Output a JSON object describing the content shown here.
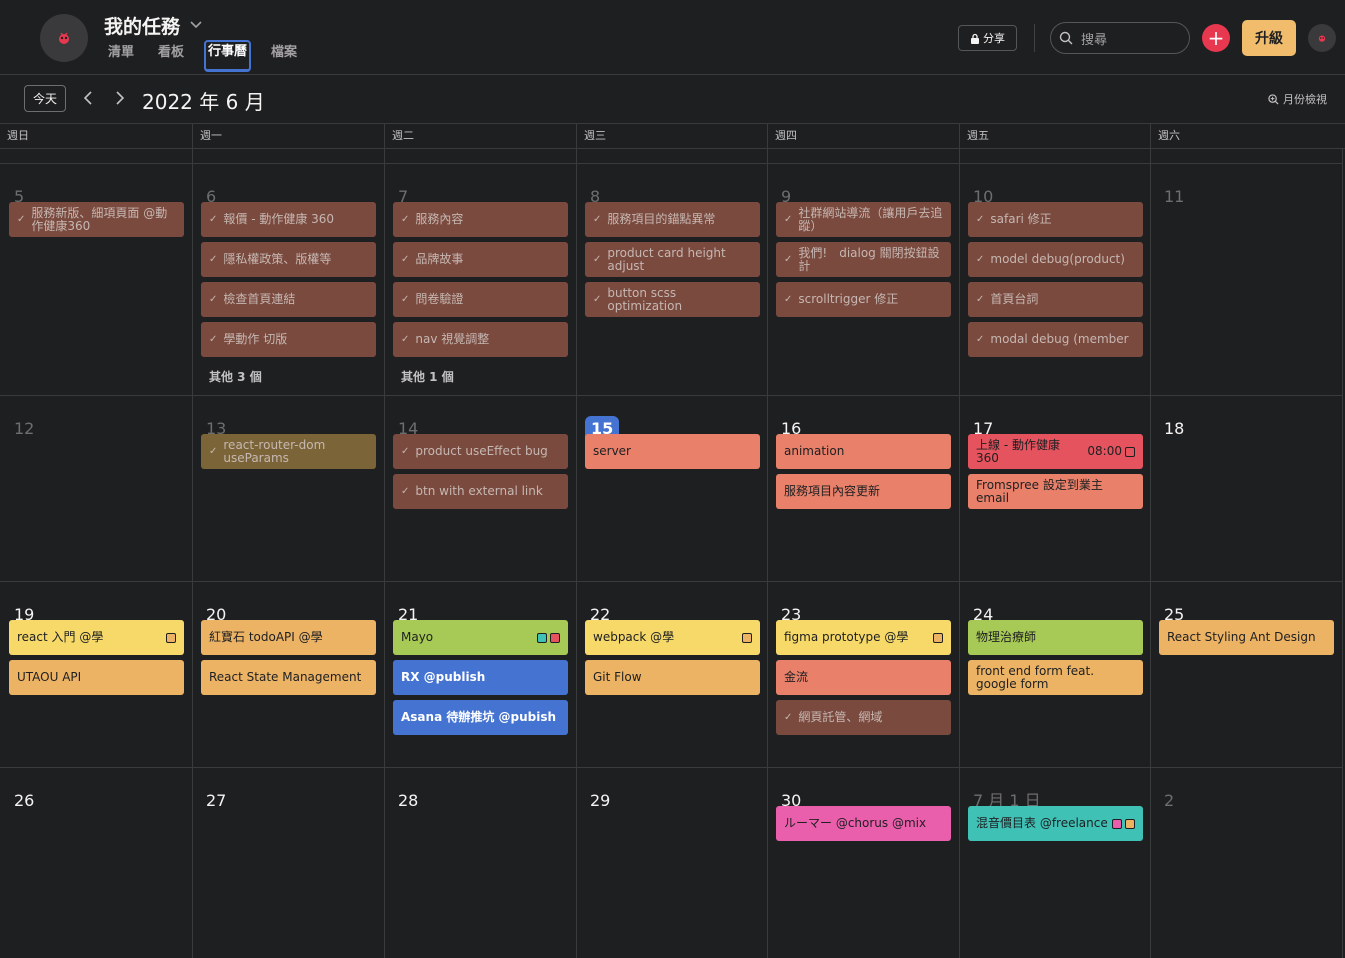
{
  "project": {
    "title": "我的任務",
    "tabs": [
      "清單",
      "看板",
      "行事曆",
      "檔案"
    ],
    "active_tab": "行事曆"
  },
  "header": {
    "share_label": "分享",
    "search_placeholder": "搜尋",
    "add_symbol": "+",
    "upgrade_label": "升級"
  },
  "toolbar": {
    "today_label": "今天",
    "month_label": "2022 年 6 月",
    "view_label": "月份檢視"
  },
  "weekdays": [
    "週日",
    "週一",
    "週二",
    "週三",
    "週四",
    "週五",
    "週六"
  ],
  "colors": {
    "done": "#7a4a3e",
    "done_olive": "#7b6538",
    "salmon": "#e8806a",
    "red": "#e5535f",
    "yellow": "#f6d969",
    "orange": "#ecb365",
    "green": "#a7c955",
    "blue": "#4573d2",
    "pink": "#ea5fac",
    "teal": "#3fc1b6"
  },
  "weeks": [
    {
      "days": [
        {
          "label": "5",
          "dim": true,
          "tasks": [
            {
              "title": "服務新版、細項頁面 @動作健康360",
              "done": true
            }
          ]
        },
        {
          "label": "6",
          "dim": true,
          "tasks": [
            {
              "title": "報價 - 動作健康 360",
              "done": true
            },
            {
              "title": "隱私權政策、版權等",
              "done": true
            },
            {
              "title": "檢查首頁連結",
              "done": true
            },
            {
              "title": "學動作 切版",
              "done": true
            }
          ],
          "more": "其他 3 個"
        },
        {
          "label": "7",
          "dim": true,
          "tasks": [
            {
              "title": "服務內容",
              "done": true
            },
            {
              "title": "品牌故事",
              "done": true
            },
            {
              "title": "問卷驗證",
              "done": true
            },
            {
              "title": "nav 視覺調整",
              "done": true
            }
          ],
          "more": "其他 1 個"
        },
        {
          "label": "8",
          "dim": true,
          "tasks": [
            {
              "title": "服務項目的錨點異常",
              "done": true
            },
            {
              "title": "product card height adjust",
              "done": true
            },
            {
              "title": "button scss optimization",
              "done": true
            }
          ]
        },
        {
          "label": "9",
          "dim": true,
          "tasks": [
            {
              "title": "社群網站導流（讓用戶去追蹤）",
              "done": true
            },
            {
              "title": "我們!　dialog 關閉按鈕設計",
              "done": true
            },
            {
              "title": "scrolltrigger 修正",
              "done": true
            }
          ]
        },
        {
          "label": "10",
          "dim": true,
          "tasks": [
            {
              "title": "safari 修正",
              "done": true
            },
            {
              "title": "model debug(product)",
              "done": true
            },
            {
              "title": "首頁台詞",
              "done": true
            },
            {
              "title": "modal debug (member",
              "done": true
            }
          ]
        },
        {
          "label": "11",
          "dim": true,
          "tasks": []
        }
      ]
    },
    {
      "days": [
        {
          "label": "12",
          "dim": true,
          "tasks": []
        },
        {
          "label": "13",
          "dim": true,
          "tasks": [
            {
              "title": "react-router-dom useParams",
              "done": true,
              "olive": true
            }
          ]
        },
        {
          "label": "14",
          "dim": true,
          "tasks": [
            {
              "title": "product useEffect bug",
              "done": true
            },
            {
              "title": "btn with external link",
              "done": true
            }
          ]
        },
        {
          "label": "15",
          "today": true,
          "tasks": [
            {
              "title": "server",
              "color": "salmon"
            }
          ]
        },
        {
          "label": "16",
          "tasks": [
            {
              "title": "animation",
              "color": "salmon"
            },
            {
              "title": "服務項目內容更新",
              "color": "salmon"
            }
          ]
        },
        {
          "label": "17",
          "tasks": [
            {
              "title": "上線 - 動作健康 360",
              "color": "red",
              "time": "08:00",
              "tags": [
                "red"
              ]
            },
            {
              "title": "Fromspree 設定到業主email",
              "color": "salmon"
            }
          ]
        },
        {
          "label": "18",
          "tasks": []
        }
      ]
    },
    {
      "days": [
        {
          "label": "19",
          "tasks": [
            {
              "title": "react 入門 @學",
              "color": "yellow",
              "tags": [
                "orange"
              ]
            },
            {
              "title": "UTAOU API",
              "color": "orange"
            }
          ]
        },
        {
          "label": "20",
          "tasks": [
            {
              "title": "紅寶石 todoAPI @學",
              "color": "orange"
            },
            {
              "title": "React State Management",
              "color": "orange"
            }
          ]
        },
        {
          "label": "21",
          "tasks": [
            {
              "title": "Mayo",
              "color": "green",
              "tags": [
                "teal",
                "red"
              ]
            },
            {
              "title": "RX @publish",
              "color": "blue"
            },
            {
              "title": "Asana 待辦推坑 @pubish",
              "color": "blue"
            }
          ]
        },
        {
          "label": "22",
          "tasks": [
            {
              "title": "webpack @學",
              "color": "yellow",
              "tags": [
                "orange"
              ]
            },
            {
              "title": "Git Flow",
              "color": "orange"
            }
          ]
        },
        {
          "label": "23",
          "tasks": [
            {
              "title": "figma prototype @學",
              "color": "yellow",
              "tags": [
                "orange"
              ]
            },
            {
              "title": "金流",
              "color": "salmon"
            },
            {
              "title": "網頁託管、網域",
              "done": true
            }
          ]
        },
        {
          "label": "24",
          "tasks": [
            {
              "title": "物理治療師",
              "color": "green"
            },
            {
              "title": "front end form feat. google form",
              "color": "orange"
            }
          ]
        },
        {
          "label": "25",
          "tasks": [
            {
              "title": "React Styling Ant Design",
              "color": "orange"
            }
          ]
        }
      ]
    },
    {
      "days": [
        {
          "label": "26",
          "tasks": []
        },
        {
          "label": "27",
          "tasks": []
        },
        {
          "label": "28",
          "tasks": []
        },
        {
          "label": "29",
          "tasks": []
        },
        {
          "label": "30",
          "tasks": [
            {
              "title": "ルーマー @chorus @mix",
              "color": "pink"
            }
          ]
        },
        {
          "label": "7 月 1 日",
          "dim": true,
          "tasks": [
            {
              "title": "混音價目表 @freelance",
              "color": "teal",
              "tags": [
                "pink",
                "orange"
              ]
            }
          ]
        },
        {
          "label": "2",
          "dim": true,
          "tasks": []
        }
      ]
    }
  ]
}
